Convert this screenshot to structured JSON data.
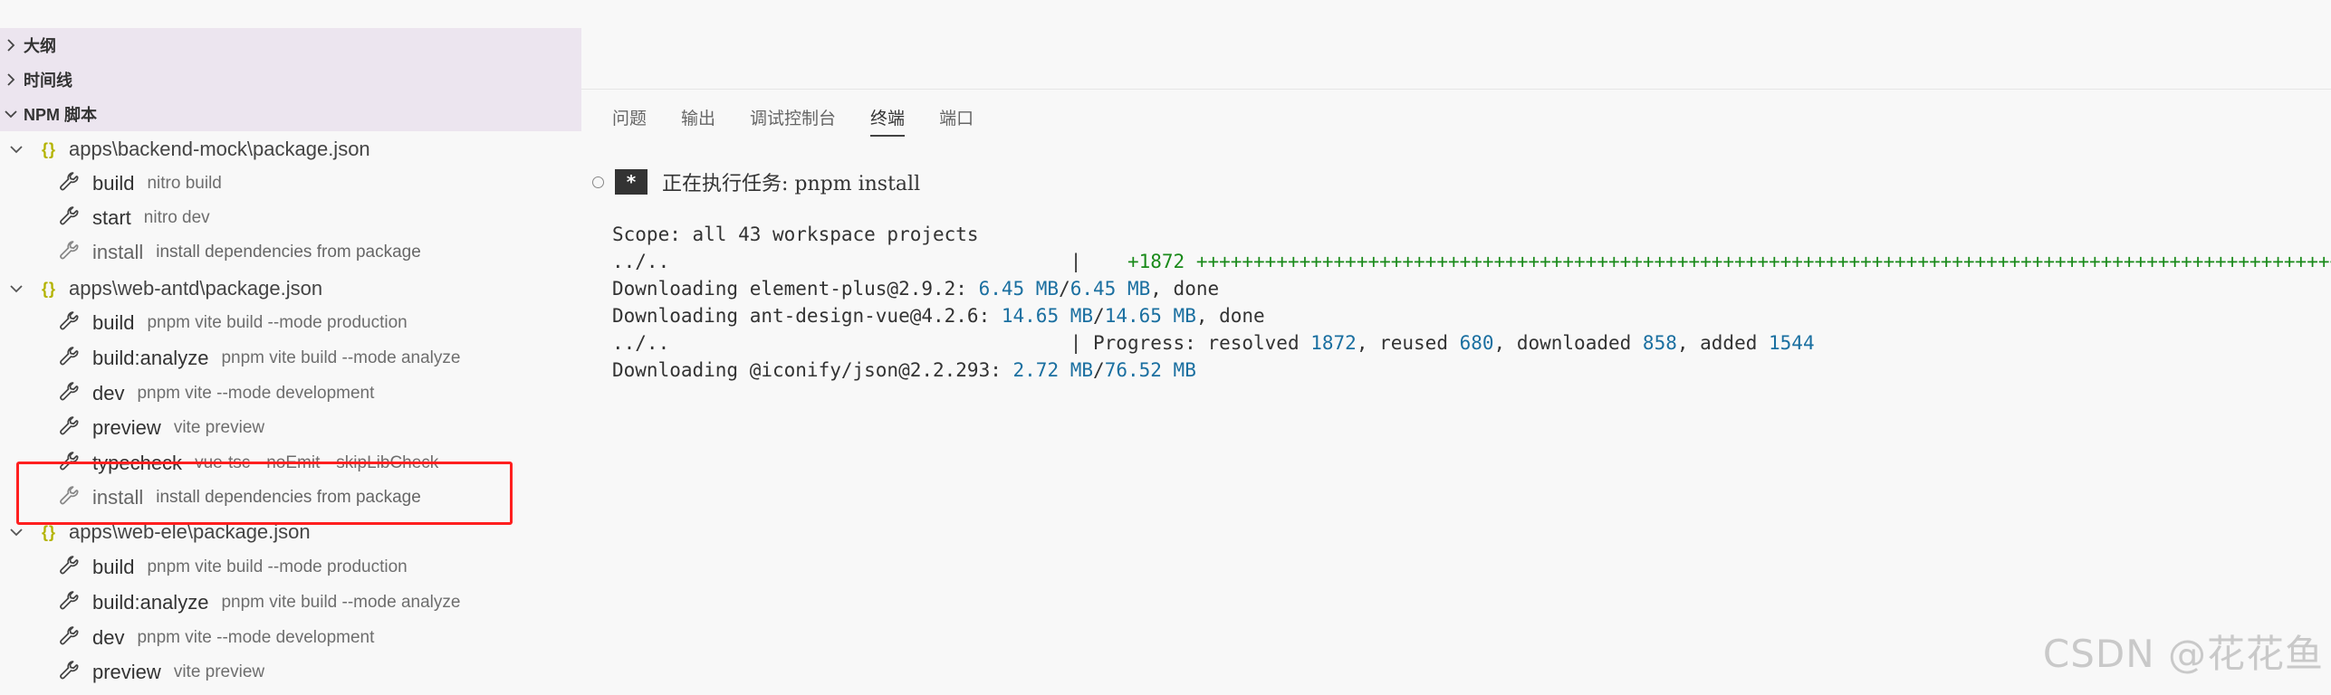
{
  "sidebar": {
    "sections": [
      {
        "label": "大纲",
        "expanded": false
      },
      {
        "label": "时间线",
        "expanded": false
      },
      {
        "label": "NPM 脚本",
        "expanded": true
      }
    ],
    "packages": [
      {
        "label": "apps\\backend-mock\\package.json",
        "scripts": [
          {
            "name": "build",
            "cmd": "nitro build"
          },
          {
            "name": "start",
            "cmd": "nitro dev"
          },
          {
            "name": "install",
            "cmd": "install dependencies from package"
          }
        ]
      },
      {
        "label": "apps\\web-antd\\package.json",
        "scripts": [
          {
            "name": "build",
            "cmd": "pnpm vite build --mode production"
          },
          {
            "name": "build:analyze",
            "cmd": "pnpm vite build --mode analyze"
          },
          {
            "name": "dev",
            "cmd": "pnpm vite --mode development"
          },
          {
            "name": "preview",
            "cmd": "vite preview"
          },
          {
            "name": "typecheck",
            "cmd": "vue-tsc --noEmit --skipLibCheck"
          },
          {
            "name": "install",
            "cmd": "install dependencies from package"
          }
        ]
      },
      {
        "label": "apps\\web-ele\\package.json",
        "scripts": [
          {
            "name": "build",
            "cmd": "pnpm vite build --mode production"
          },
          {
            "name": "build:analyze",
            "cmd": "pnpm vite build --mode analyze"
          },
          {
            "name": "dev",
            "cmd": "pnpm vite --mode development"
          },
          {
            "name": "preview",
            "cmd": "vite preview"
          }
        ]
      }
    ],
    "icons": {
      "package": "json-braces-icon",
      "script": "wrench-icon",
      "expand": "chevron-down-icon",
      "collapse": "chevron-right-icon"
    }
  },
  "panel": {
    "tabs": [
      "问题",
      "输出",
      "调试控制台",
      "终端",
      "端口"
    ],
    "active_tab": "终端"
  },
  "terminal": {
    "task_badge": "*",
    "task_text": "正在执行任务: pnpm install",
    "scope_line": "Scope: all 43 workspace projects",
    "line2_prefix": "../..                                   |    ",
    "line2_count": "+1872",
    "line2_plus": " ++++++++++++++++++++++++++++++++++++++++++++++++++++++++++++++++++++++++++++++++++++++++++++++++++++++",
    "dl1_prefix": "Downloading element-plus@2.9.2: ",
    "dl1_a": "6.45 MB",
    "dl1_sep": "/",
    "dl1_b": "6.45 MB",
    "dl1_suffix": ", done",
    "dl2_prefix": "Downloading ant-design-vue@4.2.6: ",
    "dl2_a": "14.65 MB",
    "dl2_sep": "/",
    "dl2_b": "14.65 MB",
    "dl2_suffix": ", done",
    "prog_prefix": "../..                                   | Progress: resolved ",
    "prog_resolved": "1872",
    "prog_t1": ", reused ",
    "prog_reused": "680",
    "prog_t2": ", downloaded ",
    "prog_downloaded": "858",
    "prog_t3": ", added ",
    "prog_added": "1544",
    "dl3_prefix": "Downloading @iconify/json@2.2.293: ",
    "dl3_a": "2.72 MB",
    "dl3_sep": "/",
    "dl3_b": "76.52 MB"
  },
  "watermark": "CSDN @花花鱼",
  "colors": {
    "accent_number": "#1a6fa0",
    "progress_green": "#1a8a1a",
    "highlight": "#ff1f1f"
  }
}
